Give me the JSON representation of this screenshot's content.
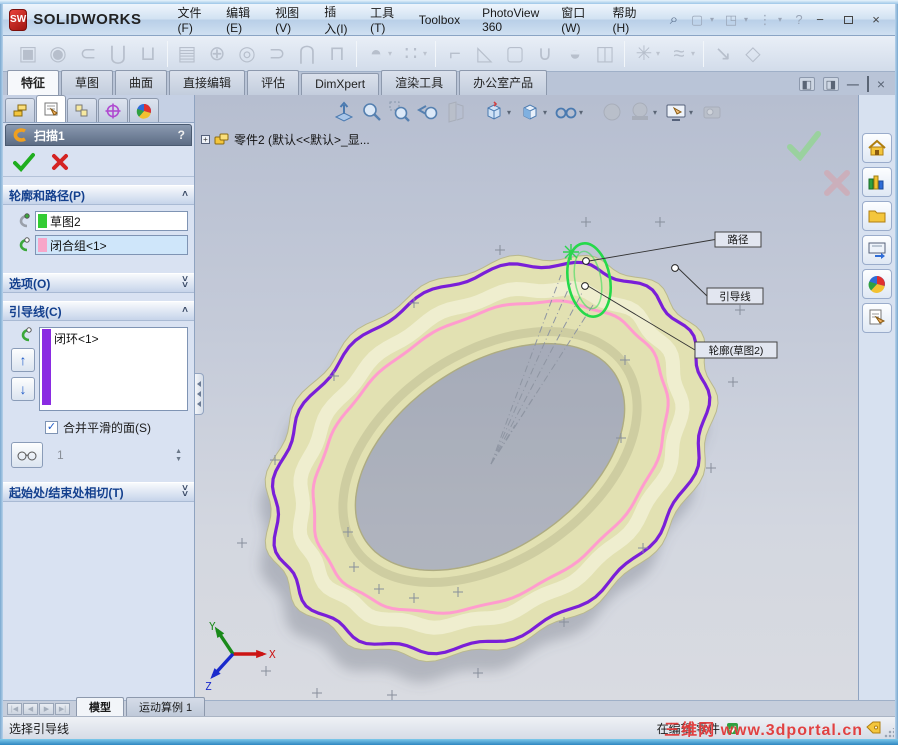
{
  "titlebar": {
    "logo_text": "SW",
    "app_name": "SOLIDWORKS",
    "menus": [
      "文件(F)",
      "编辑(E)",
      "视图(V)",
      "插入(I)",
      "工具(T)",
      "Toolbox",
      "PhotoView 360",
      "窗口(W)",
      "帮助(H)"
    ],
    "quick_icons": [
      "search",
      "new-document",
      "open-document",
      "options",
      "help"
    ],
    "window_controls": [
      "minimize",
      "maximize",
      "close"
    ]
  },
  "command_manager": {
    "tabs": [
      "特征",
      "草图",
      "曲面",
      "直接编辑",
      "评估",
      "DimXpert",
      "渲染工具",
      "办公室产品"
    ],
    "active_tab": "特征",
    "doc_controls": [
      "toggle-left-pane",
      "toggle-right-pane",
      "minimize-doc",
      "restore-doc",
      "close-doc"
    ]
  },
  "feature_toolbar": [
    {
      "name": "extruded-boss",
      "glyph": "▣"
    },
    {
      "name": "revolved-boss",
      "glyph": "◉"
    },
    {
      "name": "swept-boss",
      "glyph": "⊂"
    },
    {
      "name": "lofted-boss",
      "glyph": "⋃"
    },
    {
      "name": "boundary-boss",
      "glyph": "⊔",
      "sep": true
    },
    {
      "name": "extruded-cut",
      "glyph": "▤"
    },
    {
      "name": "hole-wizard",
      "glyph": "⊕"
    },
    {
      "name": "revolved-cut",
      "glyph": "◎"
    },
    {
      "name": "swept-cut",
      "glyph": "⊃"
    },
    {
      "name": "lofted-cut",
      "glyph": "⋂"
    },
    {
      "name": "boundary-cut",
      "glyph": "⊓",
      "sep": true
    },
    {
      "name": "fillet",
      "glyph": "◓",
      "caret": true
    },
    {
      "name": "linear-pattern",
      "glyph": "∷",
      "caret": true,
      "sep": true
    },
    {
      "name": "rib",
      "glyph": "⌐"
    },
    {
      "name": "draft",
      "glyph": "◺"
    },
    {
      "name": "shell",
      "glyph": "▢"
    },
    {
      "name": "wrap",
      "glyph": "∪"
    },
    {
      "name": "dome",
      "glyph": "◒"
    },
    {
      "name": "mirror",
      "glyph": "◫",
      "sep": true
    },
    {
      "name": "reference-geometry",
      "glyph": "✳",
      "caret": true
    },
    {
      "name": "curves",
      "glyph": "≈",
      "caret": true,
      "sep": true
    },
    {
      "name": "instant3d",
      "glyph": "↘"
    },
    {
      "name": "dimxpert-tools",
      "glyph": "◇"
    }
  ],
  "property_manager": {
    "panel_tabs": [
      "feature-manager",
      "property-manager",
      "configuration-manager",
      "dimxpert-manager",
      "display-manager"
    ],
    "active_panel_tab": "property-manager",
    "title": "扫描1",
    "help_label": "?",
    "groups": {
      "profile_path": {
        "header": "轮廓和路径(P)",
        "expanded": true,
        "rows": [
          {
            "label": "草图2",
            "swatch": "#33cc33",
            "selected": false,
            "icon": "profile-selector"
          },
          {
            "label": "闭合组<1>",
            "swatch": "#f7a6c9",
            "selected": true,
            "icon": "path-selector"
          }
        ]
      },
      "options": {
        "header": "选项(O)",
        "expanded": false
      },
      "guide_curves": {
        "header": "引导线(C)",
        "expanded": true,
        "rows": [
          {
            "label": "闭环<1>",
            "swatch": "#8a2be2"
          }
        ],
        "move_up": "up-arrow",
        "move_down": "down-arrow",
        "merge_faces_checkbox": {
          "label": "合并平滑的面(S)",
          "checked": true
        },
        "section_preview_value": "1"
      },
      "tangency": {
        "header": "起始处/结束处相切(T)",
        "expanded": false
      }
    }
  },
  "viewport": {
    "document_label": "零件2 (默认<<默认>_显...",
    "callouts": {
      "path": "路径",
      "guide": "引导线",
      "profile": "轮廓(草图2)"
    },
    "colors": {
      "body": "#e2e1b2",
      "body_edge": "#b9b88e",
      "path": "#ff9cce",
      "guide": "#7a1fd8",
      "profile": "#25d94a",
      "background_top": "#b6bed0",
      "background_bottom": "#d9dbe1"
    },
    "triad_labels": {
      "x": "X",
      "y": "Y",
      "z": "Z"
    },
    "headsup": [
      {
        "name": "normal-to-view"
      },
      {
        "name": "zoom-fit"
      },
      {
        "name": "zoom-area"
      },
      {
        "name": "previous-view"
      },
      {
        "name": "section-view",
        "disabled": true,
        "gap": true
      },
      {
        "name": "view-orientation",
        "caret": true
      },
      {
        "name": "display-style",
        "caret": true
      },
      {
        "name": "hide-show-items",
        "caret": true,
        "gap": true
      },
      {
        "name": "edit-appearance",
        "disabled": true
      },
      {
        "name": "apply-scene",
        "disabled": true,
        "caret": true
      },
      {
        "name": "view-settings",
        "caret": true
      },
      {
        "name": "measure",
        "disabled": true
      }
    ]
  },
  "task_pane": [
    "solidworks-resources",
    "design-library",
    "file-explorer",
    "view-palette",
    "appearances",
    "custom-properties"
  ],
  "bottom": {
    "tabs": [
      "模型",
      "运动算例 1"
    ],
    "active_tab": "模型",
    "status_left": "选择引导线",
    "status_right": "在编辑 零件",
    "watermark": "三维网 www.3dportal.cn"
  }
}
